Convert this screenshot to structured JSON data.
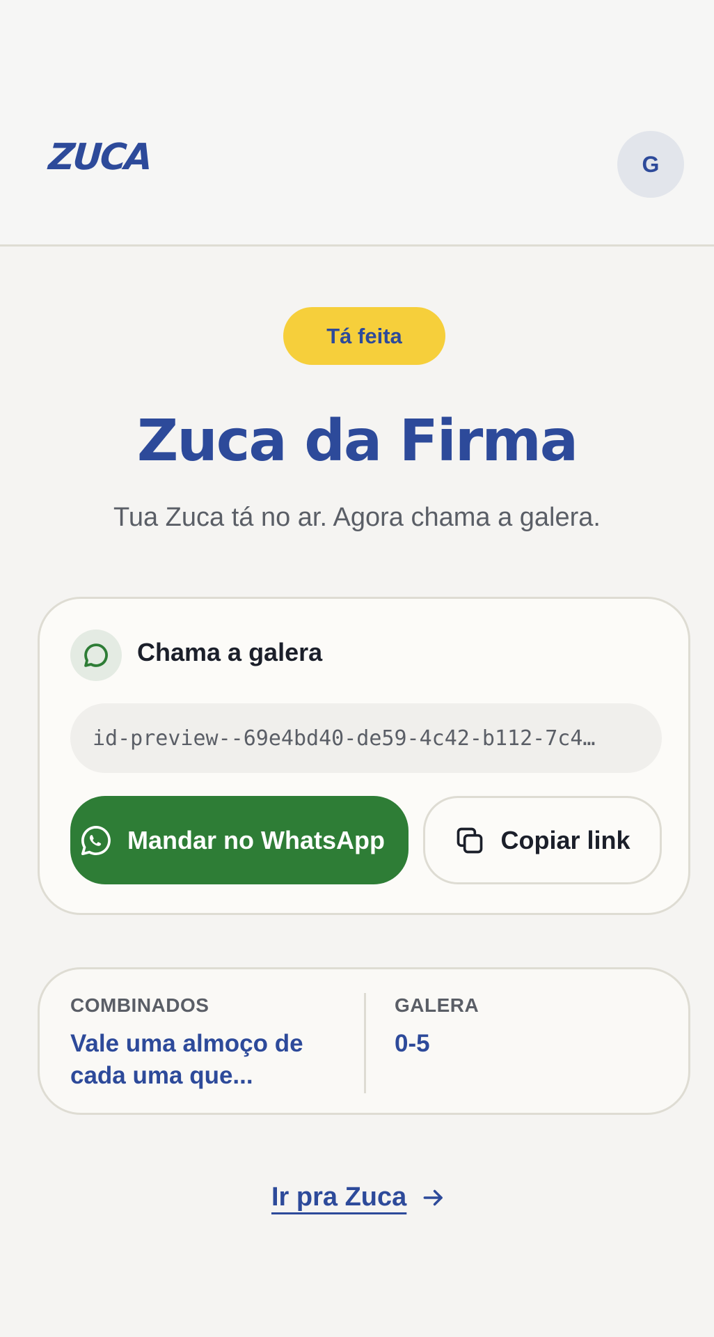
{
  "header": {
    "logo_text": "ZUCA",
    "avatar_initial": "G"
  },
  "status": {
    "label": "Tá feita",
    "color": "#f6cf3b"
  },
  "main": {
    "title": "Zuca da Firma",
    "subtitle": "Tua Zuca tá no ar. Agora chama a galera."
  },
  "share": {
    "icon": "chat-bubble-icon",
    "title": "Chama a galera",
    "link_value": "id-preview--69e4bd40-de59-4c42-b112-7c4…",
    "whatsapp_label": "Mandar no WhatsApp",
    "copy_label": "Copiar link",
    "whatsapp_color": "#2e7d36"
  },
  "info": {
    "combinados_label": "COMBINADOS",
    "combinados_value": "Vale uma almoço de cada uma que...",
    "galera_label": "GALERA",
    "galera_value": "0-5"
  },
  "footer": {
    "go_link": "Ir pra Zuca"
  },
  "colors": {
    "brand": "#2d4a9a",
    "background": "#f5f4f2"
  }
}
